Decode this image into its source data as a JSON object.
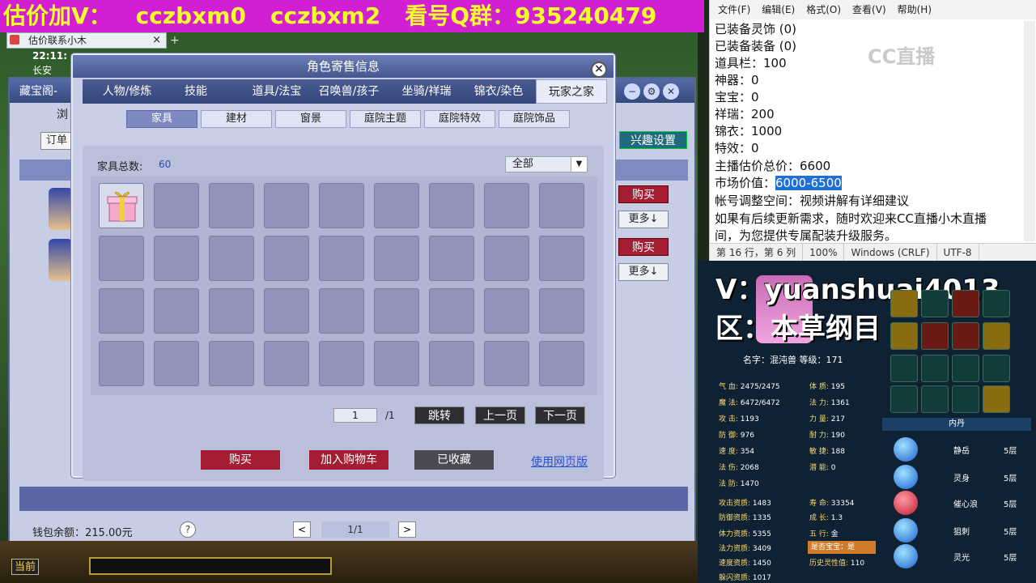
{
  "banner": {
    "parts": [
      "估价加V：",
      "cczbxm0",
      "cczbxm2",
      "看号Q群：935240479"
    ]
  },
  "browser": {
    "tab_title": "估价联系小木",
    "close": "×",
    "new_tab": "+"
  },
  "game": {
    "clock": "22:11:",
    "location": "长安",
    "shop_title": "藏宝阁-",
    "browse": "浏",
    "order_label": "订单",
    "interest_button": "兴趣设置",
    "buy_label": "购买",
    "more_label": "更多↓",
    "wallet": "钱包余额：215.00元",
    "help": "?",
    "page_indicator": "1/1",
    "current_label": "当前"
  },
  "dialog": {
    "title": "角色寄售信息",
    "close": "×",
    "tabs": [
      "人物/修炼",
      "技能",
      "道具/法宝",
      "召唤兽/孩子",
      "坐骑/祥瑞",
      "锦衣/染色",
      "玩家之家"
    ],
    "active_tab": "玩家之家",
    "subtabs": [
      "家具",
      "建材",
      "窗景",
      "庭院主题",
      "庭院特效",
      "庭院饰品"
    ],
    "active_subtab": "家具",
    "total_label": "家具总数:",
    "total_value": "60",
    "filter_value": "全部",
    "page_current": "1",
    "page_total": "/1",
    "jump_btn": "跳转",
    "prev_btn": "上一页",
    "next_btn": "下一页",
    "buy_btn": "购买",
    "cart_btn": "加入购物车",
    "fav_btn": "已收藏",
    "web_link": "使用网页版",
    "colors": {
      "buy": "#a41d32",
      "cart": "#a41d32",
      "fav": "#4a4a52",
      "link": "#2c4fd4"
    }
  },
  "notepad": {
    "menu": [
      "文件(F)",
      "编辑(E)",
      "格式(O)",
      "查看(V)",
      "帮助(H)"
    ],
    "lines": [
      "已装备灵饰  (0)",
      "已装备装备  (0)",
      "道具栏：100",
      "神器：0",
      "宝宝：0",
      "祥瑞：200",
      "锦衣：1000",
      "特效：0",
      "主播估价总价：6600"
    ],
    "market_label": "市场价值：",
    "market_value": "6000-6500",
    "lines_after": [
      "帐号调整空间：视频讲解有详细建议",
      "如果有后续更新需求，随时欢迎来CC直播小木直播",
      "间，为您提供专属配装升级服务。"
    ],
    "status": [
      "第 16 行，第 6 列",
      "100%",
      "Windows (CRLF)",
      "UTF-8"
    ],
    "logo": "CC直播"
  },
  "pet": {
    "contact": "V：yuanshuai4013",
    "area": "区：本草纲目",
    "name_line": "名字：混沌兽  等级：171",
    "stats_left": [
      {
        "label": "气  血:",
        "value": "2475/2475"
      },
      {
        "label": "魔  法:",
        "value": "6472/6472"
      },
      {
        "label": "攻  击:",
        "value": "1193"
      },
      {
        "label": "防  御:",
        "value": "976"
      },
      {
        "label": "速  度:",
        "value": "354"
      },
      {
        "label": "法  伤:",
        "value": "2068"
      },
      {
        "label": "法  防:",
        "value": "1470"
      }
    ],
    "stats_right": [
      {
        "label": "体  质:",
        "value": "195"
      },
      {
        "label": "法  力:",
        "value": "1361"
      },
      {
        "label": "力  量:",
        "value": "217"
      },
      {
        "label": "耐  力:",
        "value": "190"
      },
      {
        "label": "敏  捷:",
        "value": "188"
      },
      {
        "label": "潜  能:",
        "value": "0"
      }
    ],
    "stats_bottom_left": [
      {
        "label": "攻击资质:",
        "value": "1483"
      },
      {
        "label": "防御资质:",
        "value": "1335"
      },
      {
        "label": "体力资质:",
        "value": "5355"
      },
      {
        "label": "法力资质:",
        "value": "3409"
      },
      {
        "label": "速度资质:",
        "value": "1450"
      },
      {
        "label": "躲闪资质:",
        "value": "1017"
      }
    ],
    "stats_bottom_right": [
      {
        "label": "寿  命:",
        "value": "33354"
      },
      {
        "label": "成  长:",
        "value": "1.3"
      },
      {
        "label": "五  行:",
        "value": "金"
      }
    ],
    "baby_badge": "是否宝宝：是",
    "soul": {
      "label": "历史灵性值:",
      "value": "110"
    },
    "neidan_title": "内丹",
    "neidan": [
      {
        "name": "静岳",
        "level": "5层",
        "color": "blue"
      },
      {
        "name": "灵身",
        "level": "5层",
        "color": "blue"
      },
      {
        "name": "催心浪",
        "level": "5层",
        "color": "red"
      },
      {
        "name": "狙刺",
        "level": "5层",
        "color": "blue"
      },
      {
        "name": "灵光",
        "level": "5层",
        "color": "blue"
      }
    ]
  }
}
